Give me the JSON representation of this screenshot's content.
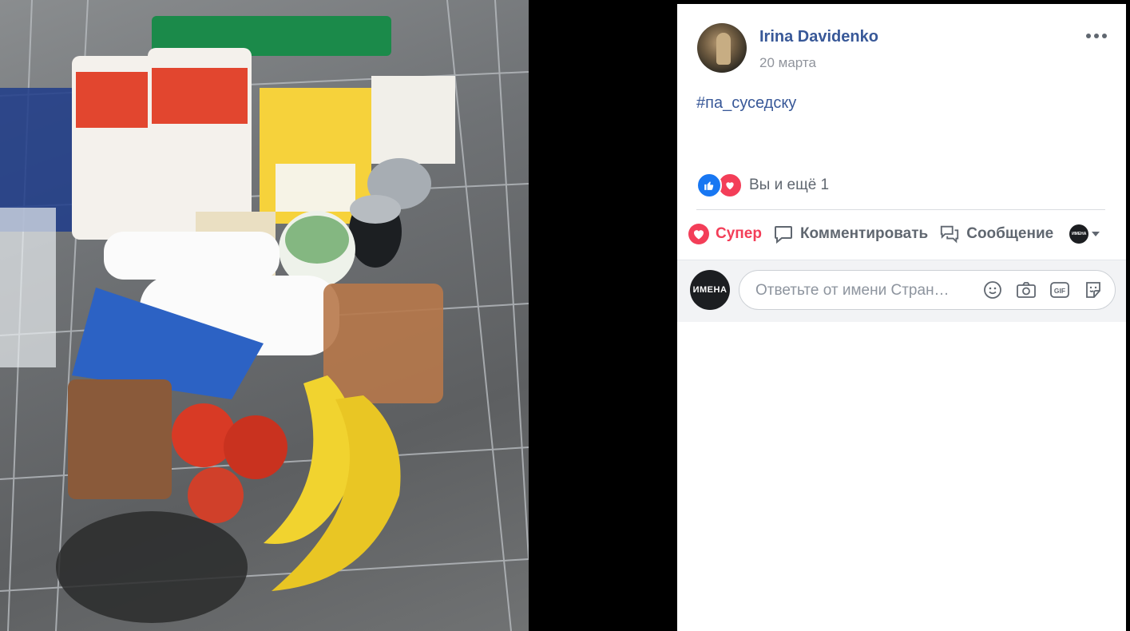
{
  "post": {
    "author": "Irina Davidenko",
    "date": "20 марта",
    "text": "#па_суседску",
    "reactions_summary": "Вы и ещё 1",
    "reaction_icons": [
      "like-icon",
      "love-icon"
    ]
  },
  "actions": {
    "super_label": "Супер",
    "comment_label": "Комментировать",
    "message_label": "Сообщение",
    "page_switch_label": "ИМЕНА"
  },
  "comment": {
    "page_avatar_text": "ИМЕНА",
    "placeholder": "Ответьте от имени Стран…",
    "gif_label": "GIF"
  },
  "colors": {
    "link": "#385898",
    "super": "#f33e58",
    "like": "#1877f2",
    "muted": "#606770"
  }
}
